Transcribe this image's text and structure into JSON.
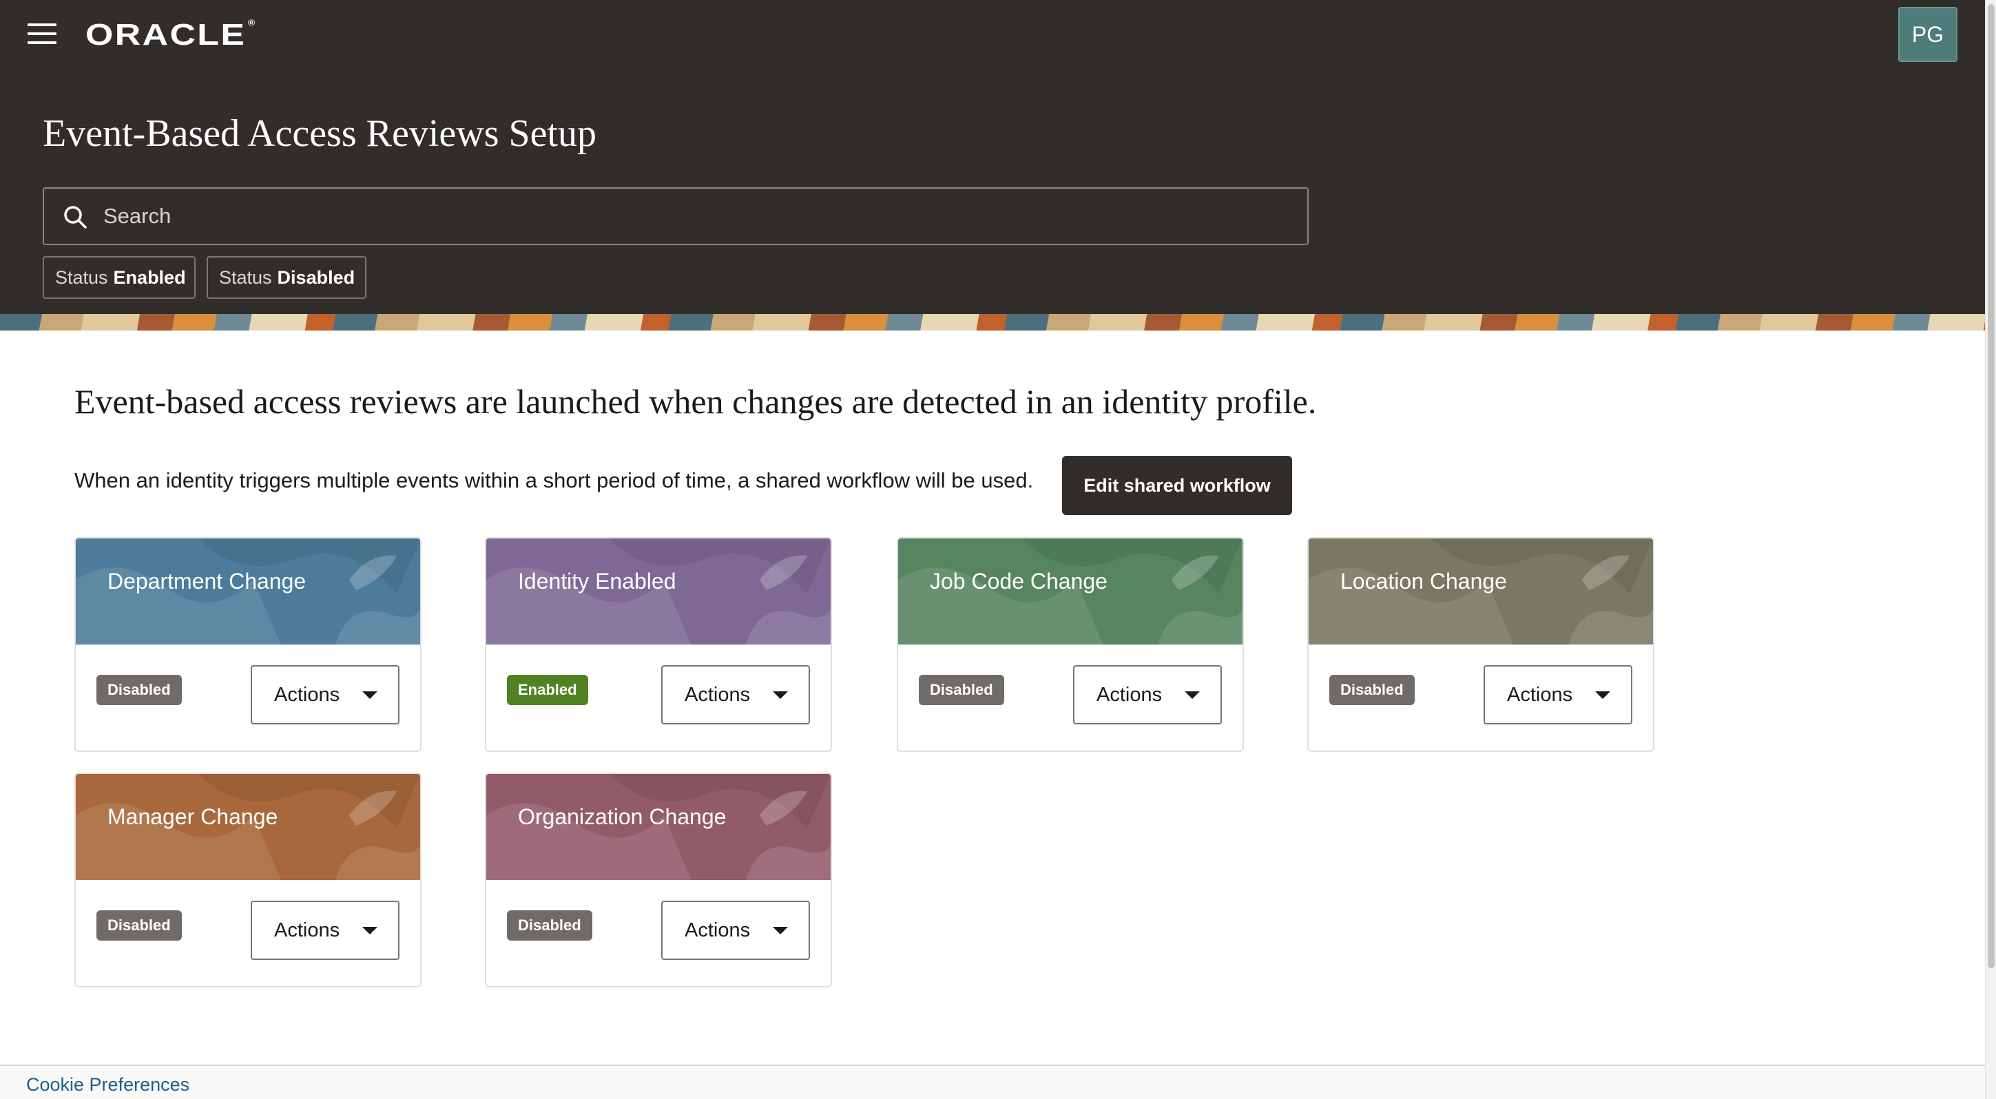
{
  "header": {
    "brand": "ORACLE",
    "avatar_initials": "PG",
    "page_title": "Event-Based Access Reviews Setup",
    "search": {
      "placeholder": "Search",
      "value": ""
    },
    "filters": [
      {
        "label": "Status",
        "value": "Enabled"
      },
      {
        "label": "Status",
        "value": "Disabled"
      }
    ]
  },
  "main": {
    "heading": "Event-based access reviews are launched when changes are detected in an identity profile.",
    "shared_workflow_text": "When an identity triggers multiple events within a short period of time, a shared workflow will be used.",
    "shared_workflow_button": "Edit shared workflow",
    "cards": [
      {
        "title": "Department Change",
        "status": "Disabled",
        "action_label": "Actions",
        "color": "#4c7c9a"
      },
      {
        "title": "Identity Enabled",
        "status": "Enabled",
        "action_label": "Actions",
        "color": "#7e6994"
      },
      {
        "title": "Job Code Change",
        "status": "Disabled",
        "action_label": "Actions",
        "color": "#568560"
      },
      {
        "title": "Location Change",
        "status": "Disabled",
        "action_label": "Actions",
        "color": "#7a7762"
      },
      {
        "title": "Manager Change",
        "status": "Disabled",
        "action_label": "Actions",
        "color": "#a9683b"
      },
      {
        "title": "Organization Change",
        "status": "Disabled",
        "action_label": "Actions",
        "color": "#925b6a"
      }
    ]
  },
  "footer": {
    "cookie_link": "Cookie Preferences"
  },
  "colors": {
    "header_bg": "#312d2a",
    "badge_enabled": "#508223",
    "badge_disabled": "#6f6b68",
    "link": "#1f5e8c"
  },
  "icons": {
    "menu": "hamburger-menu-icon",
    "search": "search-icon",
    "dropdown": "caret-down-icon"
  }
}
